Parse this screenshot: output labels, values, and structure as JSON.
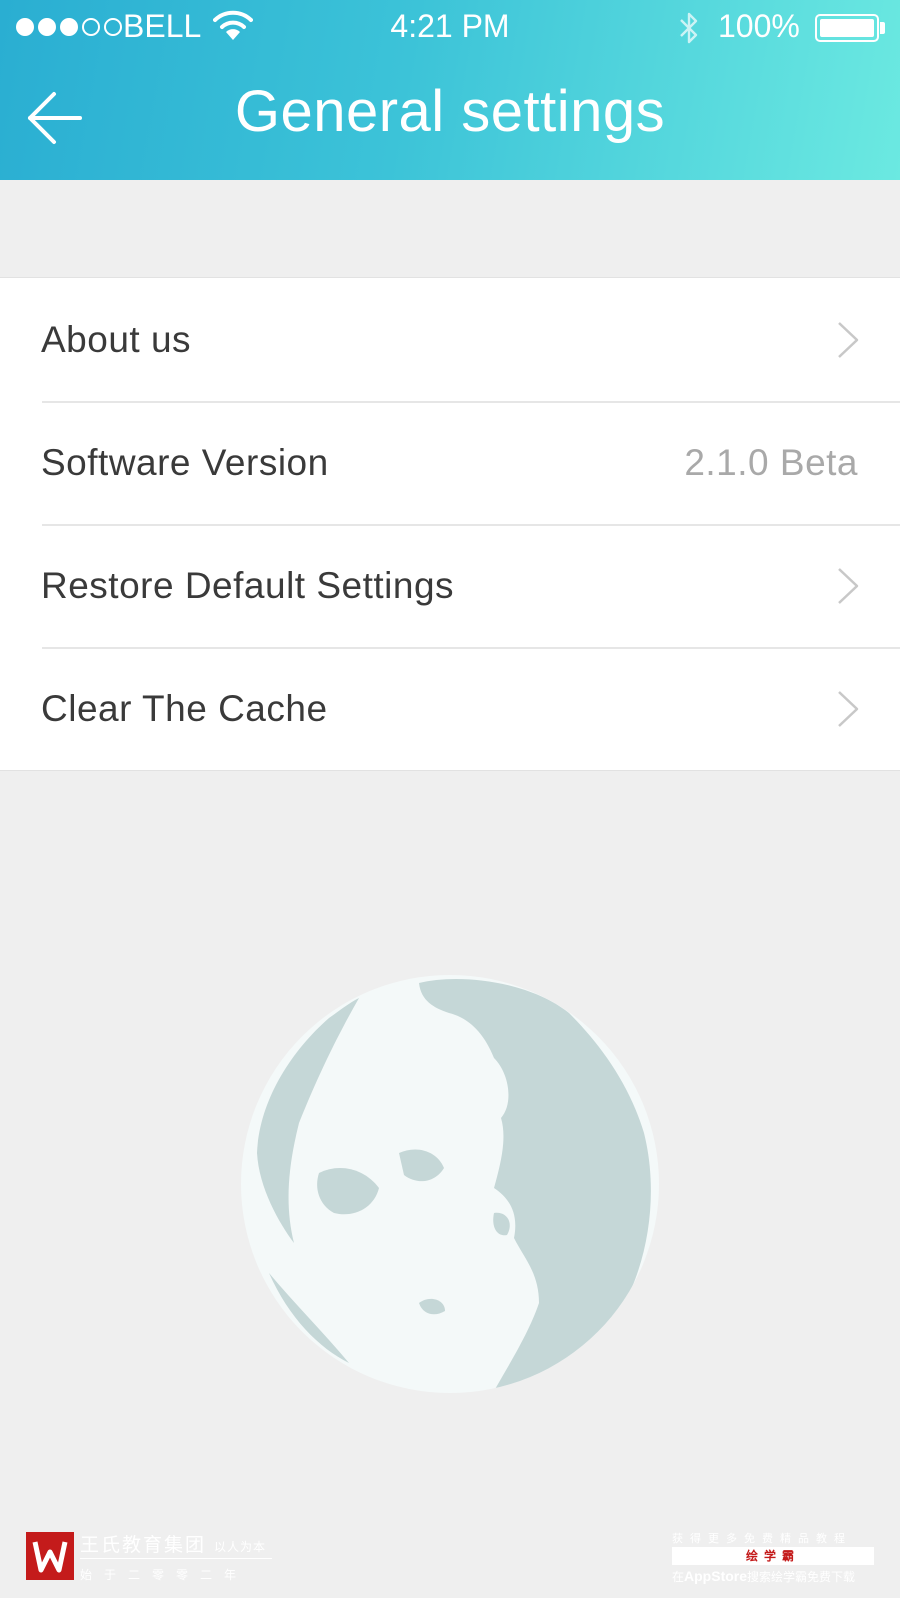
{
  "status_bar": {
    "carrier": "BELL",
    "time": "4:21 PM",
    "battery": "100%",
    "signal_bars_filled": 3,
    "signal_bars_total": 5
  },
  "header": {
    "title": "General settings",
    "back_icon": "arrow-left-icon"
  },
  "settings": {
    "items": [
      {
        "label": "About us",
        "value": "",
        "chevron": true
      },
      {
        "label": "Software Version",
        "value": "2.1.0 Beta",
        "chevron": false
      },
      {
        "label": "Restore Default Settings",
        "value": "",
        "chevron": true
      },
      {
        "label": "Clear The Cache",
        "value": "",
        "chevron": true
      }
    ]
  },
  "illustration": "globe-icon",
  "watermark": {
    "left_title": "王氏教育集团",
    "left_tagline": "以人为本",
    "left_sub": "始于二零零二年",
    "right_top": "获得更多免费精品教程",
    "right_brand": "绘学霸",
    "right_store": "AppStore",
    "right_prefix": "在",
    "right_bottom": "搜索绘学霸免费下载"
  },
  "colors": {
    "header_start": "#2aaed2",
    "header_end": "#6be9e1",
    "background": "#efefef",
    "watermark_red": "#c41b1b"
  }
}
